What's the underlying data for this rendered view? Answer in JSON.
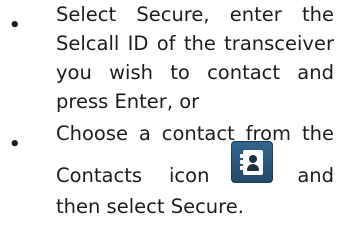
{
  "instructions": {
    "bullet_symbol": "•",
    "item1": {
      "line1": [
        "Select",
        "Secure,",
        "enter",
        "the"
      ],
      "line2": [
        "Selcall",
        "ID",
        "of",
        "the",
        "transceiver"
      ],
      "line3": [
        "you",
        "wish",
        "to",
        "contact",
        "and"
      ],
      "line4": "press Enter, or"
    },
    "item2": {
      "line1": [
        "Choose",
        "a",
        "contact",
        "from",
        "the"
      ],
      "line2_before_icon": "Contacts",
      "line2_icon_word": "icon",
      "line2_after_icon": "and",
      "line3": "then select Secure.",
      "icon_name": "contacts-book-icon"
    }
  },
  "colors": {
    "text": "#1c1c1c",
    "icon_background": "#2c5a80",
    "icon_foreground": "#ffffff"
  }
}
